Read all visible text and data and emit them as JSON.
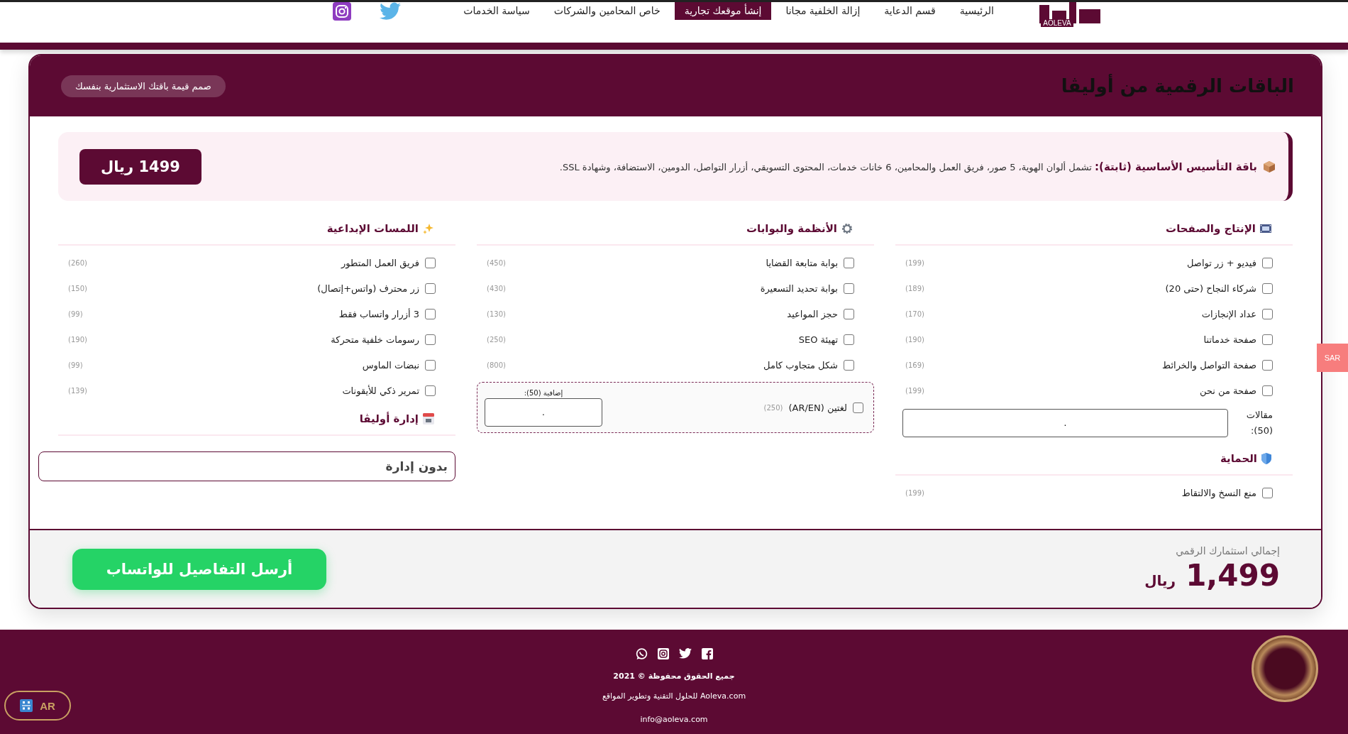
{
  "nav": {
    "logo_text": "AOLEVA",
    "links": [
      {
        "label": "الرئيسية",
        "selected": false
      },
      {
        "label": "قسم الدعاية",
        "selected": false
      },
      {
        "label": "إزالة الخلفية مجانا",
        "selected": false
      },
      {
        "label": "إنشأ موقعك تجارية",
        "selected": true
      },
      {
        "label": "خاص المحامين والشركات",
        "selected": false
      },
      {
        "label": "سياسة الخدمات",
        "selected": false
      }
    ],
    "social": [
      {
        "kind": "twitter"
      },
      {
        "kind": "instagram"
      }
    ]
  },
  "card": {
    "title": "الباقات الرقمية من أوليڤا",
    "pill": "صمم قيمة باقتك الاستثمارية بنفسك",
    "base": {
      "text": "**باقة التأسيس الأساسية (ثابتة):** تشمل ألوان الهوية، 5 صور، فريق العمل والمحامين، 6 خانات خدمات، المحتوى التسويقي، أزرار التواصل، الدومين، الاستضافة، وشهادة SSL.",
      "price": "1499 ريال"
    },
    "columns": [
      {
        "blocks": [
          {
            "kind": "section",
            "title": "الإنتاج والصفحات",
            "items": [
              {
                "label": "فيديو + زر تواصل",
                "price": "(199)",
                "checked": false
              },
              {
                "label": "شركاء النجاح (حتى 20)",
                "price": "(189)",
                "checked": false
              },
              {
                "label": "عداد الإنجازات",
                "price": "(170)",
                "checked": false
              },
              {
                "label": "صفحة خدماتنا",
                "price": "(190)",
                "checked": false
              },
              {
                "label": "صفحة التواصل والخرائط",
                "price": "(169)",
                "checked": false
              },
              {
                "label": "صفحة من نحن",
                "price": "(199)",
                "checked": false
              }
            ]
          },
          {
            "kind": "field",
            "label": "مقالات (50):",
            "value": "."
          },
          {
            "kind": "section",
            "title": "الحماية",
            "items": [
              {
                "label": "منع النسخ والالتقاط",
                "price": "(199)",
                "checked": false
              }
            ]
          }
        ]
      },
      {
        "blocks": [
          {
            "kind": "section",
            "title": "الأنظمة والبوابات",
            "items": [
              {
                "label": "بوابة متابعة القضايا",
                "price": "(450)",
                "checked": false
              },
              {
                "label": "بوابة تحديد التسعيرة",
                "price": "(430)",
                "checked": false
              },
              {
                "label": "حجز المواعيد",
                "price": "(130)",
                "checked": false
              },
              {
                "label": "تهيئة SEO",
                "price": "(250)",
                "checked": false
              },
              {
                "label": "شكل متجاوب كامل",
                "price": "(800)",
                "checked": false
              }
            ]
          },
          {
            "kind": "addon",
            "item": {
              "label": "لغتين (AR/EN)",
              "price": "(250)",
              "checked": false
            },
            "field_label": "إضافية (50):",
            "value": "."
          }
        ]
      },
      {
        "blocks": [
          {
            "kind": "section",
            "title": "اللمسات الإبداعية",
            "items": [
              {
                "label": "فريق العمل المتطور",
                "price": "(260)",
                "checked": false
              },
              {
                "label": "زر محترف (واتس+إتصال)",
                "price": "(150)",
                "checked": false
              },
              {
                "label": "3 أزرار واتساب فقط",
                "price": "(99)",
                "checked": false
              },
              {
                "label": "رسومات خلفية متحركة",
                "price": "(190)",
                "checked": false
              },
              {
                "label": "نبضات الماوس",
                "price": "(99)",
                "checked": false
              },
              {
                "label": "تمرير ذكي للأيقونات",
                "price": "(139)",
                "checked": false
              }
            ]
          },
          {
            "kind": "section",
            "title": "إدارة أوليڤا"
          },
          {
            "kind": "select",
            "value": "بدون إدارة"
          }
        ]
      }
    ],
    "total_label": "إجمالي استثمارك الرقمي",
    "total": "1,499",
    "currency": "ريال",
    "send_button": "أرسل التفاصيل للواتساب"
  },
  "currency_tab": "SAR",
  "footer": {
    "social": [
      {
        "kind": "whatsapp"
      },
      {
        "kind": "instagram"
      },
      {
        "kind": "twitter"
      },
      {
        "kind": "facebook"
      }
    ],
    "copyright": "جميع الحقوق محفوظة © 2021",
    "company": "Aoleva.com للحلول التقنية وتطوير المواقع",
    "email": "info@aoleva.com"
  },
  "language_button": "AR"
}
